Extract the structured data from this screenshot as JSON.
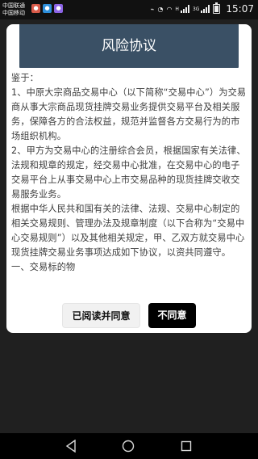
{
  "status_bar": {
    "carrier_top": "中国联通",
    "carrier_bottom": "中国移动",
    "notification_icons": [
      {
        "name": "app-notification-icon",
        "color": "#d95b4a"
      },
      {
        "name": "message-notification-icon",
        "color": "#2d8fdc"
      },
      {
        "name": "sync-notification-icon",
        "color": "#8c64e6"
      }
    ],
    "network_label_left": "H",
    "network_label_right": "3G",
    "time": "15:07",
    "battery_level": 0.75
  },
  "dialog": {
    "title": "风险协议",
    "paragraphs": [
      "鉴于：",
      "1、中原大宗商品交易中心（以下简称“交易中心”）为交易商从事大宗商品现货挂牌交易业务提供交易平台及相关服务，保障各方的合法权益，规范并监督各方交易行为的市场组织机构。",
      "2、甲方为交易中心的注册综合会员，根据国家有关法律、法规和规章的规定，经交易中心批准，在交易中心的电子交易平台上从事交易中心上市交易品种的现货挂牌交收交易服务业务。",
      "根据中华人民共和国有关的法律、法规、交易中心制定的相关交易规则、管理办法及规章制度（以下合称为“交易中心交易规则”）以及其他相关规定，甲、乙双方就交易中心现货挂牌交易业务事项达成如下协议，以资共同遵守。",
      "一、交易标的物"
    ],
    "agree_button": "已阅读并同意",
    "disagree_button": "不同意",
    "header_color": "#3a5065"
  }
}
